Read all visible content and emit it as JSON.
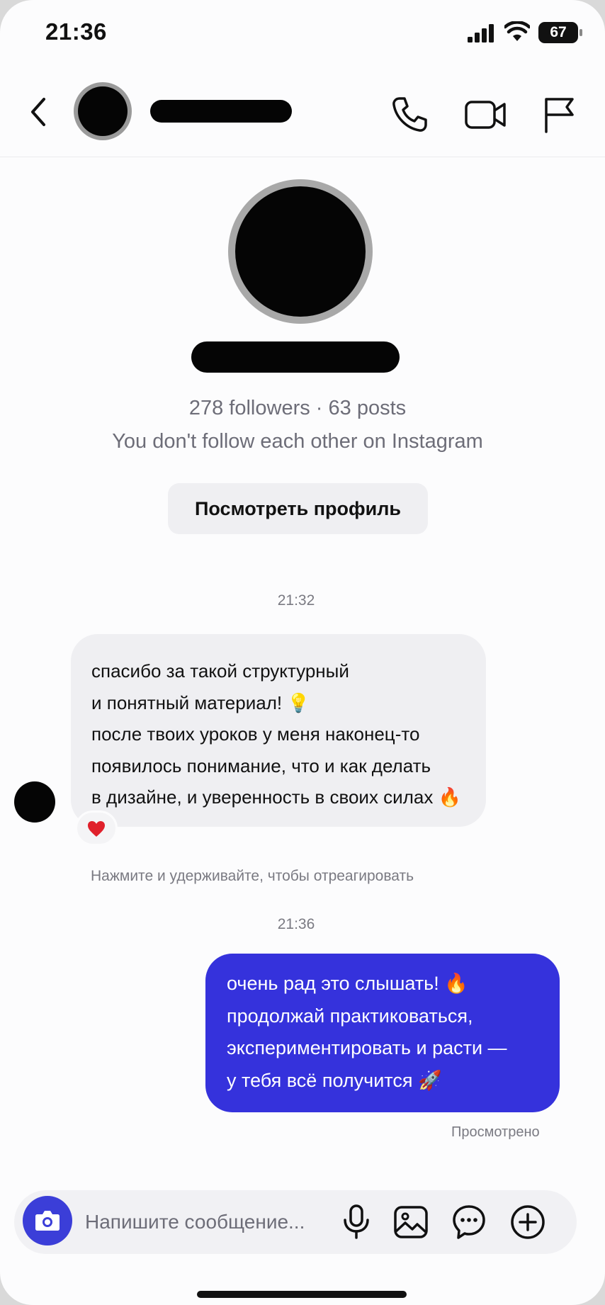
{
  "status_bar": {
    "time": "21:36",
    "battery": "67"
  },
  "header": {
    "back_icon": "chevron-left-icon",
    "call_icon": "phone-icon",
    "video_icon": "video-camera-icon",
    "report_icon": "flag-icon"
  },
  "profile": {
    "stats": "278 followers · 63 posts",
    "relationship": "You don't follow each other on Instagram",
    "view_button": "Посмотреть профиль"
  },
  "messages": [
    {
      "time": "21:32",
      "direction": "incoming",
      "lines": [
        "спасибо за такой структурный",
        "и понятный материал! 💡",
        "после твоих уроков у меня наконец-то",
        "появилось понимание, что и как делать",
        "в дизайне, и уверенность в своих силах 🔥"
      ],
      "reaction": "❤️",
      "hint": "Нажмите и удерживайте, чтобы отреагировать"
    },
    {
      "time": "21:36",
      "direction": "outgoing",
      "lines": [
        "очень рад это слышать! 🔥",
        "продолжай практиковаться,",
        "экспериментировать и расти —",
        "у тебя всё получится 🚀"
      ],
      "status": "Просмотрено"
    }
  ],
  "composer": {
    "placeholder": "Напишите сообщение...",
    "icons": [
      "camera-icon",
      "microphone-icon",
      "gallery-icon",
      "sticker-icon",
      "plus-icon"
    ]
  },
  "colors": {
    "accent": "#3b3ed8",
    "outgoing_bubble": "#3532dc",
    "incoming_bubble": "#efeff2",
    "secondary_text": "#6d6d78",
    "reaction_heart": "#e0202b"
  }
}
